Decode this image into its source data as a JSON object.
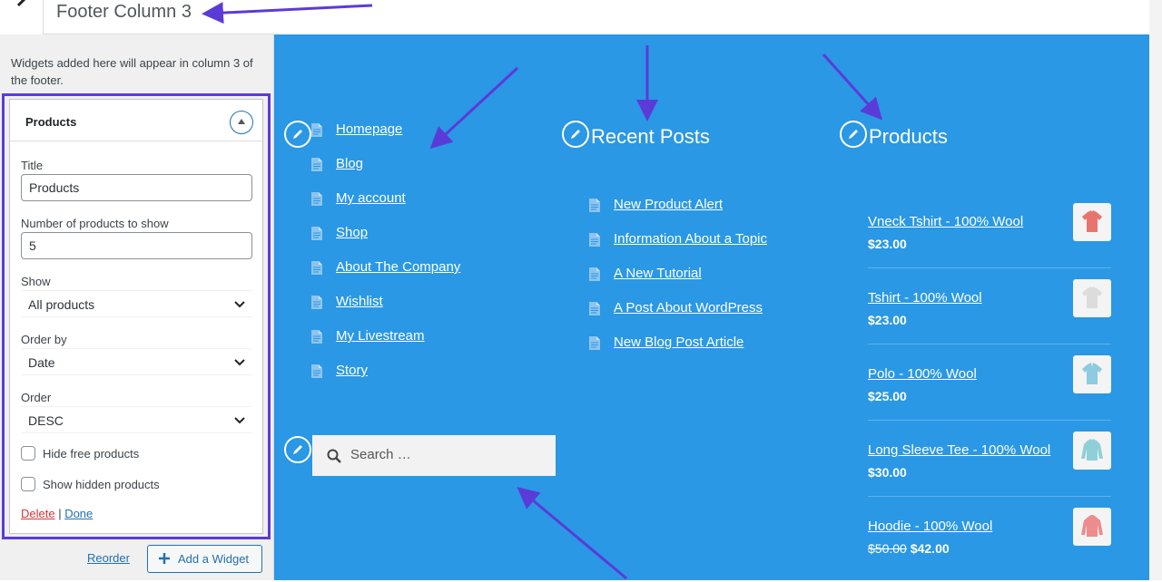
{
  "panel": {
    "title": "Footer Column 3",
    "description": "Widgets added here will appear in column 3 of the footer.",
    "widget": {
      "name": "Products",
      "fields": {
        "title_label": "Title",
        "title_value": "Products",
        "number_label": "Number of products to show",
        "number_value": "5",
        "show_label": "Show",
        "show_value": "All products",
        "orderby_label": "Order by",
        "orderby_value": "Date",
        "order_label": "Order",
        "order_value": "DESC"
      },
      "checkboxes": {
        "hide_free": "Hide free products",
        "show_hidden": "Show hidden products"
      },
      "actions": {
        "delete": "Delete",
        "separator": " | ",
        "done": "Done"
      }
    },
    "footer": {
      "reorder": "Reorder",
      "add_widget": "Add a Widget"
    }
  },
  "preview": {
    "menu_links": [
      "Homepage",
      "Blog",
      "My account",
      "Shop",
      "About The Company",
      "Wishlist",
      "My Livestream",
      "Story"
    ],
    "recent_posts": {
      "heading": "Recent Posts",
      "items": [
        "New Product Alert",
        "Information About a Topic",
        "A New Tutorial",
        "A Post About WordPress",
        "New Blog Post Article"
      ]
    },
    "products": {
      "heading": "Products",
      "items": [
        {
          "name": "Vneck Tshirt - 100% Wool",
          "price": "$23.00",
          "old_price": "",
          "color": "#e8756d",
          "icon": "tshirt-icon"
        },
        {
          "name": "Tshirt - 100% Wool",
          "price": "$23.00",
          "old_price": "",
          "color": "#dcdcdc",
          "icon": "tshirt-icon"
        },
        {
          "name": "Polo - 100% Wool",
          "price": "$25.00",
          "old_price": "",
          "color": "#8ccbe0",
          "icon": "polo-icon"
        },
        {
          "name": "Long Sleeve Tee - 100% Wool",
          "price": "$30.00",
          "old_price": "",
          "color": "#8fd0d8",
          "icon": "longsleeve-icon"
        },
        {
          "name": "Hoodie - 100% Wool",
          "price": "$42.00",
          "old_price": "$50.00",
          "color": "#ec8c8c",
          "icon": "hoodie-icon"
        }
      ]
    },
    "search": {
      "placeholder": "Search …"
    }
  },
  "colors": {
    "preview_bg": "#2a98e4",
    "annotation": "#5b3bd8",
    "link": "#2271b1",
    "delete": "#d63638"
  }
}
